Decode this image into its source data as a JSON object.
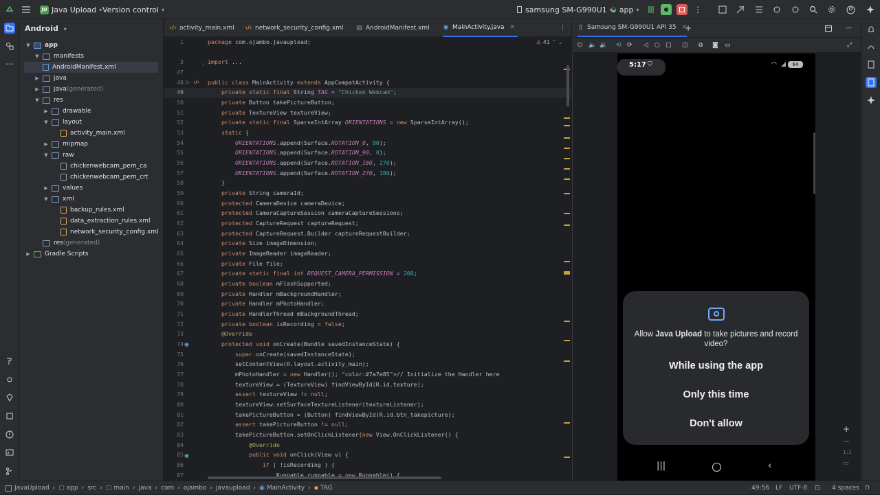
{
  "topbar": {
    "project_badge": "JU",
    "project_name": "Java Upload",
    "vcs": "Version control",
    "device": "samsung SM-G990U1",
    "run_config": "app"
  },
  "tree": {
    "header": "Android",
    "nodes": [
      {
        "label": "app",
        "suffix": ""
      },
      {
        "label": "manifests",
        "suffix": ""
      },
      {
        "label": "AndroidManifest.xml",
        "suffix": ""
      },
      {
        "label": "java",
        "suffix": ""
      },
      {
        "label": "java",
        "suffix": " (generated)"
      },
      {
        "label": "res",
        "suffix": ""
      },
      {
        "label": "drawable",
        "suffix": ""
      },
      {
        "label": "layout",
        "suffix": ""
      },
      {
        "label": "activity_main.xml",
        "suffix": ""
      },
      {
        "label": "mipmap",
        "suffix": ""
      },
      {
        "label": "raw",
        "suffix": ""
      },
      {
        "label": "chickenwebcam_pem_ca",
        "suffix": ""
      },
      {
        "label": "chickenwebcam_pem_crt",
        "suffix": ""
      },
      {
        "label": "values",
        "suffix": ""
      },
      {
        "label": "xml",
        "suffix": ""
      },
      {
        "label": "backup_rules.xml",
        "suffix": ""
      },
      {
        "label": "data_extraction_rules.xml",
        "suffix": ""
      },
      {
        "label": "network_security_config.xml",
        "suffix": ""
      },
      {
        "label": "res",
        "suffix": " (generated)"
      },
      {
        "label": "Gradle Scripts",
        "suffix": ""
      }
    ]
  },
  "editor_tabs": [
    "activity_main.xml",
    "network_security_config.xml",
    "AndroidManifest.xml",
    "MainActivity.java"
  ],
  "inspection_count": "41",
  "code_lines": [
    {
      "n": "1",
      "t": "package com.ojambo.javaupload;"
    },
    {
      "n": "",
      "t": ""
    },
    {
      "n": "3",
      "t": "import ..."
    },
    {
      "n": "47",
      "t": ""
    },
    {
      "n": "48",
      "t": "public class MainActivity extends AppCompatActivity {"
    },
    {
      "n": "49",
      "t": "    private static final String TAG = \"Chicken Webcam\";"
    },
    {
      "n": "50",
      "t": "    private Button takePictureButton;"
    },
    {
      "n": "51",
      "t": "    private TextureView textureView;"
    },
    {
      "n": "52",
      "t": "    private static final SparseIntArray ORIENTATIONS = new SparseIntArray();"
    },
    {
      "n": "53",
      "t": "    static {"
    },
    {
      "n": "54",
      "t": "        ORIENTATIONS.append(Surface.ROTATION_0, 90);"
    },
    {
      "n": "55",
      "t": "        ORIENTATIONS.append(Surface.ROTATION_90, 0);"
    },
    {
      "n": "56",
      "t": "        ORIENTATIONS.append(Surface.ROTATION_180, 270);"
    },
    {
      "n": "57",
      "t": "        ORIENTATIONS.append(Surface.ROTATION_270, 180);"
    },
    {
      "n": "58",
      "t": "    }"
    },
    {
      "n": "59",
      "t": "    private String cameraId;"
    },
    {
      "n": "60",
      "t": "    protected CameraDevice cameraDevice;"
    },
    {
      "n": "61",
      "t": "    protected CameraCaptureSession cameraCaptureSessions;"
    },
    {
      "n": "62",
      "t": "    protected CaptureRequest captureRequest;"
    },
    {
      "n": "63",
      "t": "    protected CaptureRequest.Builder captureRequestBuilder;"
    },
    {
      "n": "64",
      "t": "    private Size imageDimension;"
    },
    {
      "n": "65",
      "t": "    private ImageReader imageReader;"
    },
    {
      "n": "66",
      "t": "    private File file;"
    },
    {
      "n": "67",
      "t": "    private static final int REQUEST_CAMERA_PERMISSION = 200;"
    },
    {
      "n": "68",
      "t": "    private boolean mFlashSupported;"
    },
    {
      "n": "69",
      "t": "    private Handler mBackgroundHandler;"
    },
    {
      "n": "70",
      "t": "    private Handler mPhotoHandler;"
    },
    {
      "n": "71",
      "t": "    private HandlerThread mBackgroundThread;"
    },
    {
      "n": "72",
      "t": "    private boolean isRecording = false;"
    },
    {
      "n": "73",
      "t": "    @Override"
    },
    {
      "n": "74",
      "t": "    protected void onCreate(Bundle savedInstanceState) {"
    },
    {
      "n": "75",
      "t": "        super.onCreate(savedInstanceState);"
    },
    {
      "n": "76",
      "t": "        setContentView(R.layout.activity_main);"
    },
    {
      "n": "77",
      "t": "        mPhotoHandler = new Handler(); // Initialize the Handler here"
    },
    {
      "n": "78",
      "t": "        textureView = (TextureView) findViewById(R.id.texture);"
    },
    {
      "n": "79",
      "t": "        assert textureView != null;"
    },
    {
      "n": "80",
      "t": "        textureView.setSurfaceTextureListener(textureListener);"
    },
    {
      "n": "81",
      "t": "        takePictureButton = (Button) findViewById(R.id.btn_takepicture);"
    },
    {
      "n": "82",
      "t": "        assert takePictureButton != null;"
    },
    {
      "n": "83",
      "t": "        takePictureButton.setOnClickListener(new View.OnClickListener() {"
    },
    {
      "n": "84",
      "t": "            @Override"
    },
    {
      "n": "85",
      "t": "            public void onClick(View v) {"
    },
    {
      "n": "86",
      "t": "                if ( !isRecording ) {"
    },
    {
      "n": "87",
      "t": "                    Runnable runnable = new Runnable() {"
    }
  ],
  "device_tab": "Samsung SM-G990U1 API 35",
  "phone": {
    "time": "5:17",
    "battery": "64",
    "dialog": {
      "prefix": "Allow ",
      "app": "Java Upload",
      "suffix": " to take pictures and record video?",
      "opt1": "While using the app",
      "opt2": "Only this time",
      "opt3": "Don't allow"
    }
  },
  "breadcrumb": [
    "JavaUpload",
    "app",
    "src",
    "main",
    "java",
    "com",
    "ojambo",
    "javaupload",
    "MainActivity",
    "TAG"
  ],
  "status": {
    "position": "49:56",
    "line_sep": "LF",
    "encoding": "UTF-8",
    "indent": "4 spaces"
  }
}
